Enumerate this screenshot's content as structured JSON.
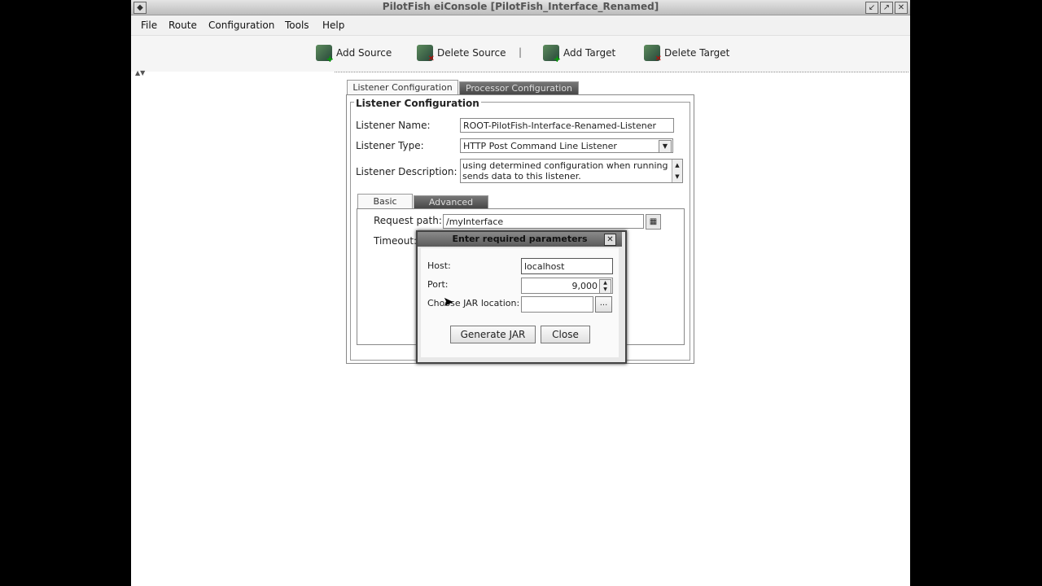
{
  "window": {
    "title": "PilotFish eiConsole [PilotFish_Interface_Renamed]"
  },
  "menu": [
    "File",
    "Route",
    "Configuration",
    "Tools",
    "Help"
  ],
  "toolbar": {
    "add_source": "Add Source",
    "delete_source": "Delete Source",
    "separator": "|",
    "add_target": "Add Target",
    "delete_target": "Delete Target"
  },
  "tabs": {
    "listener": "Listener Configuration",
    "processor": "Processor Configuration"
  },
  "listener": {
    "section_title": "Listener Configuration",
    "name_label": "Listener Name:",
    "name_value": "ROOT-PilotFish-Interface-Renamed-Listener",
    "type_label": "Listener Type:",
    "type_value": "HTTP Post Command Line Listener",
    "desc_label": "Listener Description:",
    "desc_line1": "using determined configuration when running",
    "desc_line2": "sends data to this listener."
  },
  "subtabs": {
    "basic": "Basic",
    "advanced": "Advanced"
  },
  "basic": {
    "request_path_label": "Request path:",
    "request_path_value": "/myInterface",
    "timeout_label": "Timeout:"
  },
  "dialog": {
    "title": "Enter required parameters",
    "host_label": "Host:",
    "host_value": "localhost",
    "port_label": "Port:",
    "port_value": "9,000",
    "jar_label": "Choose JAR location:",
    "jar_value": "",
    "browse_label": "...",
    "generate_button": "Generate JAR",
    "close_button": "Close"
  }
}
